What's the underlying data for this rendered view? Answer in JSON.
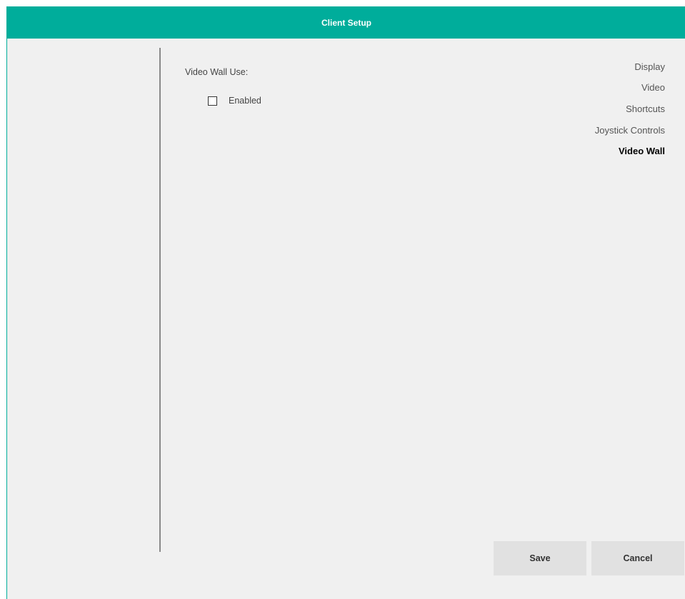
{
  "window": {
    "title": "Client Setup"
  },
  "sidebar": {
    "items": [
      {
        "label": "Display",
        "active": false
      },
      {
        "label": "Video",
        "active": false
      },
      {
        "label": "Shortcuts",
        "active": false
      },
      {
        "label": "Joystick Controls",
        "active": false
      },
      {
        "label": "Video Wall",
        "active": true
      }
    ]
  },
  "main": {
    "section_label": "Video Wall Use:",
    "enabled_checkbox": {
      "label": "Enabled",
      "checked": false
    }
  },
  "footer": {
    "save_label": "Save",
    "cancel_label": "Cancel"
  },
  "colors": {
    "accent": "#00ad9b",
    "background": "#f0f0f0",
    "button": "#e1e1e1"
  }
}
